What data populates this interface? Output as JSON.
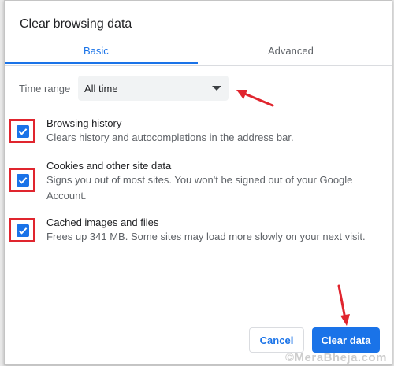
{
  "dialog": {
    "title": "Clear browsing data"
  },
  "tabs": [
    {
      "label": "Basic",
      "active": true
    },
    {
      "label": "Advanced",
      "active": false
    }
  ],
  "time_range": {
    "label": "Time range",
    "value": "All time"
  },
  "items": [
    {
      "title": "Browsing history",
      "description": "Clears history and autocompletions in the address bar.",
      "checked": true
    },
    {
      "title": "Cookies and other site data",
      "description": "Signs you out of most sites. You won't be signed out of your Google Account.",
      "checked": true
    },
    {
      "title": "Cached images and files",
      "description": "Frees up 341 MB. Some sites may load more slowly on your next visit.",
      "checked": true
    }
  ],
  "buttons": {
    "cancel": "Cancel",
    "clear": "Clear data"
  },
  "colors": {
    "accent": "#1a73e8",
    "annotation": "#e0252e"
  },
  "watermark": "©MeraBheja.com"
}
